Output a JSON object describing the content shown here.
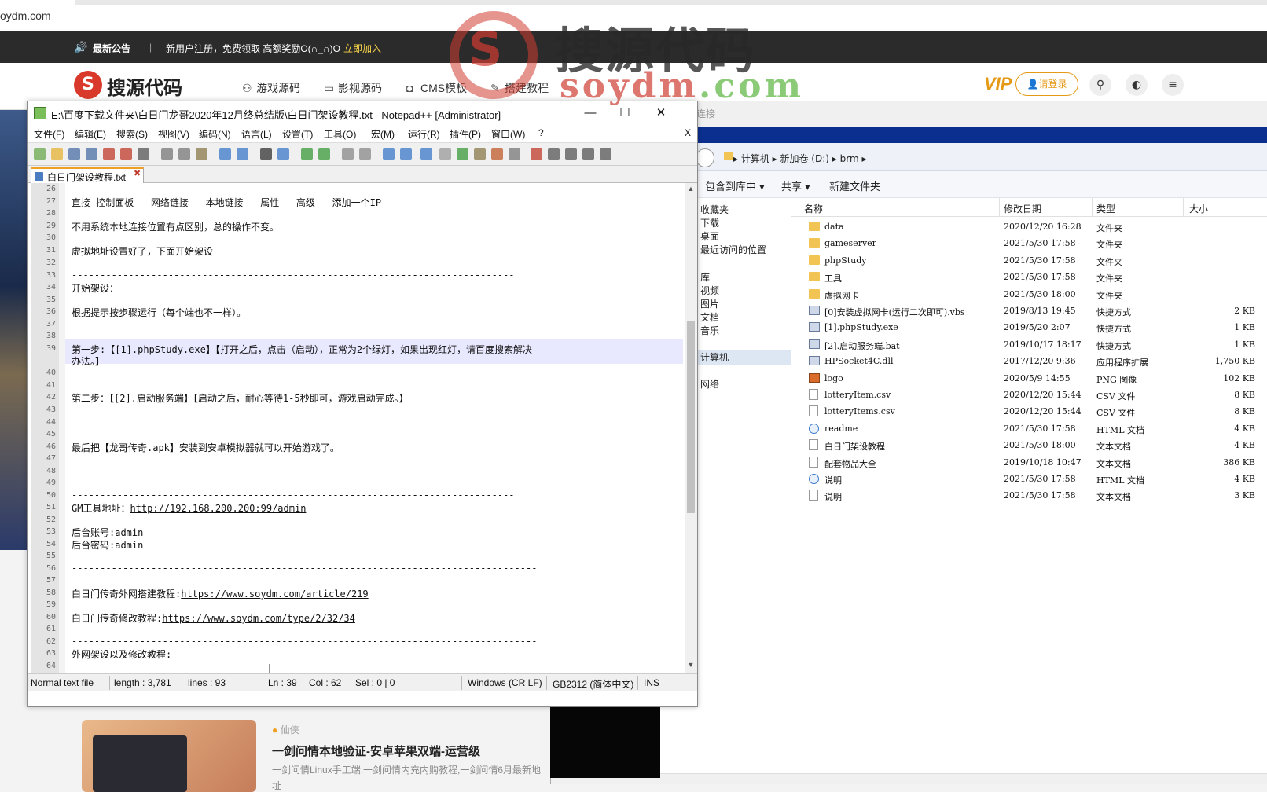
{
  "browser": {
    "url_fragment": "oydm.com"
  },
  "notice": {
    "title": "最新公告",
    "separator": "|",
    "message": "新用户注册，免费领取 高额奖励O(∩_∩)O",
    "cta": "立即加入"
  },
  "site": {
    "logo_text": "搜源代码",
    "nav": [
      {
        "icon": "gamepad-icon",
        "label": "游戏源码"
      },
      {
        "icon": "monitor-icon",
        "label": "影视源码"
      },
      {
        "icon": "shield-icon",
        "label": "CMS模板"
      },
      {
        "icon": "wrench-icon",
        "label": "搭建教程"
      }
    ],
    "vip_label": "VIP",
    "login_label": "请登录"
  },
  "watermark": {
    "title": "搜源代码",
    "domain_a": "soydm",
    "domain_b": ".com"
  },
  "page_bg": {
    "tag": "仙侠",
    "article_title": "一剑问情本地验证-安卓苹果双端-运营级",
    "article_desc": "一剑问情Linux手工端,一剑问情内充内购教程,一剑问情6月最新地址"
  },
  "explorer": {
    "hint": "连接",
    "breadcrumb": "▸ 计算机 ▸ 新加卷 (D:) ▸ brm ▸",
    "toolbar": [
      "包含到库中 ▾",
      "共享 ▾",
      "新建文件夹"
    ],
    "nav": [
      {
        "label": "收藏夹",
        "selected": false
      },
      {
        "label": "下载",
        "selected": false
      },
      {
        "label": "桌面",
        "selected": false
      },
      {
        "label": "最近访问的位置",
        "selected": false
      },
      {
        "label": "库",
        "selected": false
      },
      {
        "label": "视频",
        "selected": false
      },
      {
        "label": "图片",
        "selected": false
      },
      {
        "label": "文档",
        "selected": false
      },
      {
        "label": "音乐",
        "selected": false
      },
      {
        "label": "计算机",
        "selected": true
      },
      {
        "label": "网络",
        "selected": false
      }
    ],
    "columns": {
      "name": "名称",
      "modified": "修改日期",
      "type": "类型",
      "size": "大小"
    },
    "files": [
      {
        "icon": "folder",
        "name": "data",
        "modified": "2020/12/20 16:28",
        "type": "文件夹",
        "size": ""
      },
      {
        "icon": "folder",
        "name": "gameserver",
        "modified": "2021/5/30 17:58",
        "type": "文件夹",
        "size": ""
      },
      {
        "icon": "folder",
        "name": "phpStudy",
        "modified": "2021/5/30 17:58",
        "type": "文件夹",
        "size": ""
      },
      {
        "icon": "folder",
        "name": "工具",
        "modified": "2021/5/30 17:58",
        "type": "文件夹",
        "size": ""
      },
      {
        "icon": "folder",
        "name": "虚拟网卡",
        "modified": "2021/5/30 18:00",
        "type": "文件夹",
        "size": ""
      },
      {
        "icon": "shortcut",
        "name": "[0]安装虚拟网卡(运行二次即可).vbs",
        "modified": "2019/8/13 19:45",
        "type": "快捷方式",
        "size": "2 KB"
      },
      {
        "icon": "shortcut",
        "name": "[1].phpStudy.exe",
        "modified": "2019/5/20 2:07",
        "type": "快捷方式",
        "size": "1 KB"
      },
      {
        "icon": "shortcut",
        "name": "[2].启动服务端.bat",
        "modified": "2019/10/17 18:17",
        "type": "快捷方式",
        "size": "1 KB"
      },
      {
        "icon": "shortcut",
        "name": "HPSocket4C.dll",
        "modified": "2017/12/20 9:36",
        "type": "应用程序扩展",
        "size": "1,750 KB"
      },
      {
        "icon": "png",
        "name": "logo",
        "modified": "2020/5/9 14:55",
        "type": "PNG 图像",
        "size": "102 KB"
      },
      {
        "icon": "file",
        "name": "lotteryItem.csv",
        "modified": "2020/12/20 15:44",
        "type": "CSV 文件",
        "size": "8 KB"
      },
      {
        "icon": "file",
        "name": "lotteryItems.csv",
        "modified": "2020/12/20 15:44",
        "type": "CSV 文件",
        "size": "8 KB"
      },
      {
        "icon": "html",
        "name": "readme",
        "modified": "2021/5/30 17:58",
        "type": "HTML 文档",
        "size": "4 KB"
      },
      {
        "icon": "file",
        "name": "白日门架设教程",
        "modified": "2021/5/30 18:00",
        "type": "文本文档",
        "size": "4 KB"
      },
      {
        "icon": "file",
        "name": "配套物品大全",
        "modified": "2019/10/18 10:47",
        "type": "文本文档",
        "size": "386 KB"
      },
      {
        "icon": "html",
        "name": "说明",
        "modified": "2021/5/30 17:58",
        "type": "HTML 文档",
        "size": "4 KB"
      },
      {
        "icon": "file",
        "name": "说明",
        "modified": "2021/5/30 17:58",
        "type": "文本文档",
        "size": "3 KB"
      }
    ]
  },
  "npp": {
    "title": "E:\\百度下载文件夹\\白日门龙哥2020年12月终总结版\\白日门架设教程.txt - Notepad++ [Administrator]",
    "menu": [
      "文件(F)",
      "编辑(E)",
      "搜索(S)",
      "视图(V)",
      "编码(N)",
      "语言(L)",
      "设置(T)",
      "工具(O)",
      "宏(M)",
      "运行(R)",
      "插件(P)",
      "窗口(W)",
      "?"
    ],
    "close_doc": "X",
    "tab": "白日门架设教程.txt",
    "line_numbers": [
      "26",
      "27",
      "28",
      "29",
      "30",
      "31",
      "32",
      "33",
      "34",
      "35",
      "36",
      "37",
      "38",
      "39",
      "",
      "40",
      "41",
      "42",
      "43",
      "44",
      "45",
      "46",
      "47",
      "48",
      "49",
      "50",
      "51",
      "52",
      "53",
      "54",
      "55",
      "56",
      "57",
      "58",
      "59",
      "60",
      "61",
      "62",
      "63",
      "64"
    ],
    "lines": {
      "l27": "直接 控制面板 - 网络链接 - 本地链接 - 属性 - 高级 - 添加一个IP",
      "l29": "不用系统本地连接位置有点区别，总的操作不变。",
      "l31": "虚拟地址设置好了，下面开始架设",
      "l33": "------------------------------------------------------------------------------",
      "l34": "开始架设：",
      "l36": "根据提示按步骤运行（每个端也不一样）。",
      "l39a": "第一步:【[1].phpStudy.exe】【打开之后，点击（启动），正常为2个绿灯，如果出现红灯，请百度搜索解决",
      "l39b": "办法。】",
      "l42": "第二步：【[2].启动服务端】【启动之后，耐心等待1-5秒即可，游戏启动完成。】",
      "l46": "最后把【龙哥传奇.apk】安装到安卓模拟器就可以开始游戏了。",
      "l50": "------------------------------------------------------------------------------",
      "l51_label": "GM工具地址：",
      "l51_link": "http://192.168.200.200:99/admin",
      "l53": "后台账号:admin",
      "l54": "后台密码:admin",
      "l56": "----------------------------------------------------------------------------------",
      "l58_label": "白日门传奇外网搭建教程:",
      "l58_link": "https://www.soydm.com/article/219",
      "l60_label": "白日门传奇修改教程:",
      "l60_link": "https://www.soydm.com/type/2/32/34",
      "l62": "----------------------------------------------------------------------------------",
      "l63": "外网架设以及修改教程:"
    },
    "status": {
      "type": "Normal text file",
      "length": "length : 3,781",
      "lines": "lines : 93",
      "ln": "Ln : 39",
      "col": "Col : 62",
      "sel": "Sel : 0 | 0",
      "eol": "Windows (CR LF)",
      "enc": "GB2312 (简体中文)",
      "mode": "INS"
    }
  }
}
